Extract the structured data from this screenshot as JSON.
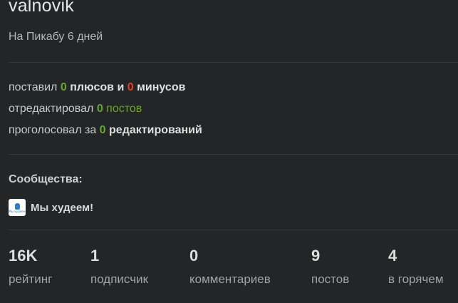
{
  "profile": {
    "username": "valnovik",
    "since": "На Пикабу 6 дней"
  },
  "activity": {
    "line1": {
      "prefix": "поставил",
      "pluses": "0",
      "middle": "плюсов и",
      "minuses": "0",
      "suffix": "минусов"
    },
    "line2": {
      "prefix": "отредактировал",
      "count": "0",
      "suffix": "постов"
    },
    "line3": {
      "prefix": "проголосовал за",
      "count": "0",
      "suffix": "редактирований"
    }
  },
  "communities": {
    "title": "Сообщества:",
    "items": [
      {
        "name": "Мы худеем!",
        "avatar_text": "Мы худеем",
        "avatar_color": "#2f7fc2"
      }
    ]
  },
  "stats": [
    {
      "value": "16K",
      "label": "рейтинг"
    },
    {
      "value": "1",
      "label": "подписчик"
    },
    {
      "value": "0",
      "label": "комментариев"
    },
    {
      "value": "9",
      "label": "постов"
    },
    {
      "value": "4",
      "label": "в горячем"
    }
  ],
  "colors": {
    "background": "#242526",
    "positive": "#6aa636",
    "negative": "#e0412f"
  }
}
